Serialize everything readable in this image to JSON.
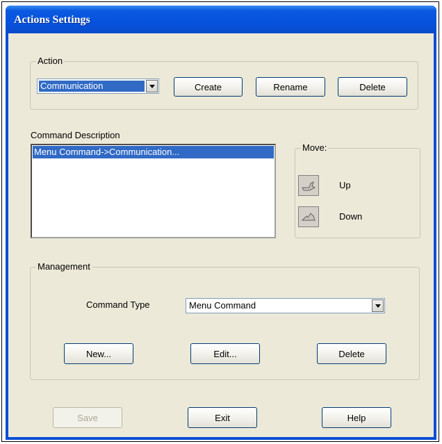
{
  "window": {
    "title": "Actions Settings"
  },
  "action": {
    "legend": "Action",
    "selected": "Communication",
    "create_label": "Create",
    "rename_label": "Rename",
    "delete_label": "Delete"
  },
  "command_description": {
    "label": "Command Description",
    "items": [
      "Menu Command->Communication..."
    ]
  },
  "move": {
    "legend": "Move:",
    "up_label": "Up",
    "down_label": "Down",
    "up_icon": "up-arrow-icon",
    "down_icon": "down-arrow-icon"
  },
  "management": {
    "legend": "Management",
    "command_type_label": "Command Type",
    "command_type_value": "Menu Command",
    "new_label": "New...",
    "edit_label": "Edit...",
    "delete_label": "Delete"
  },
  "footer": {
    "save_label": "Save",
    "exit_label": "Exit",
    "help_label": "Help"
  },
  "colors": {
    "titlebar": "#0653e0",
    "dialog_bg": "#ece9d8",
    "selection": "#316ac5"
  }
}
